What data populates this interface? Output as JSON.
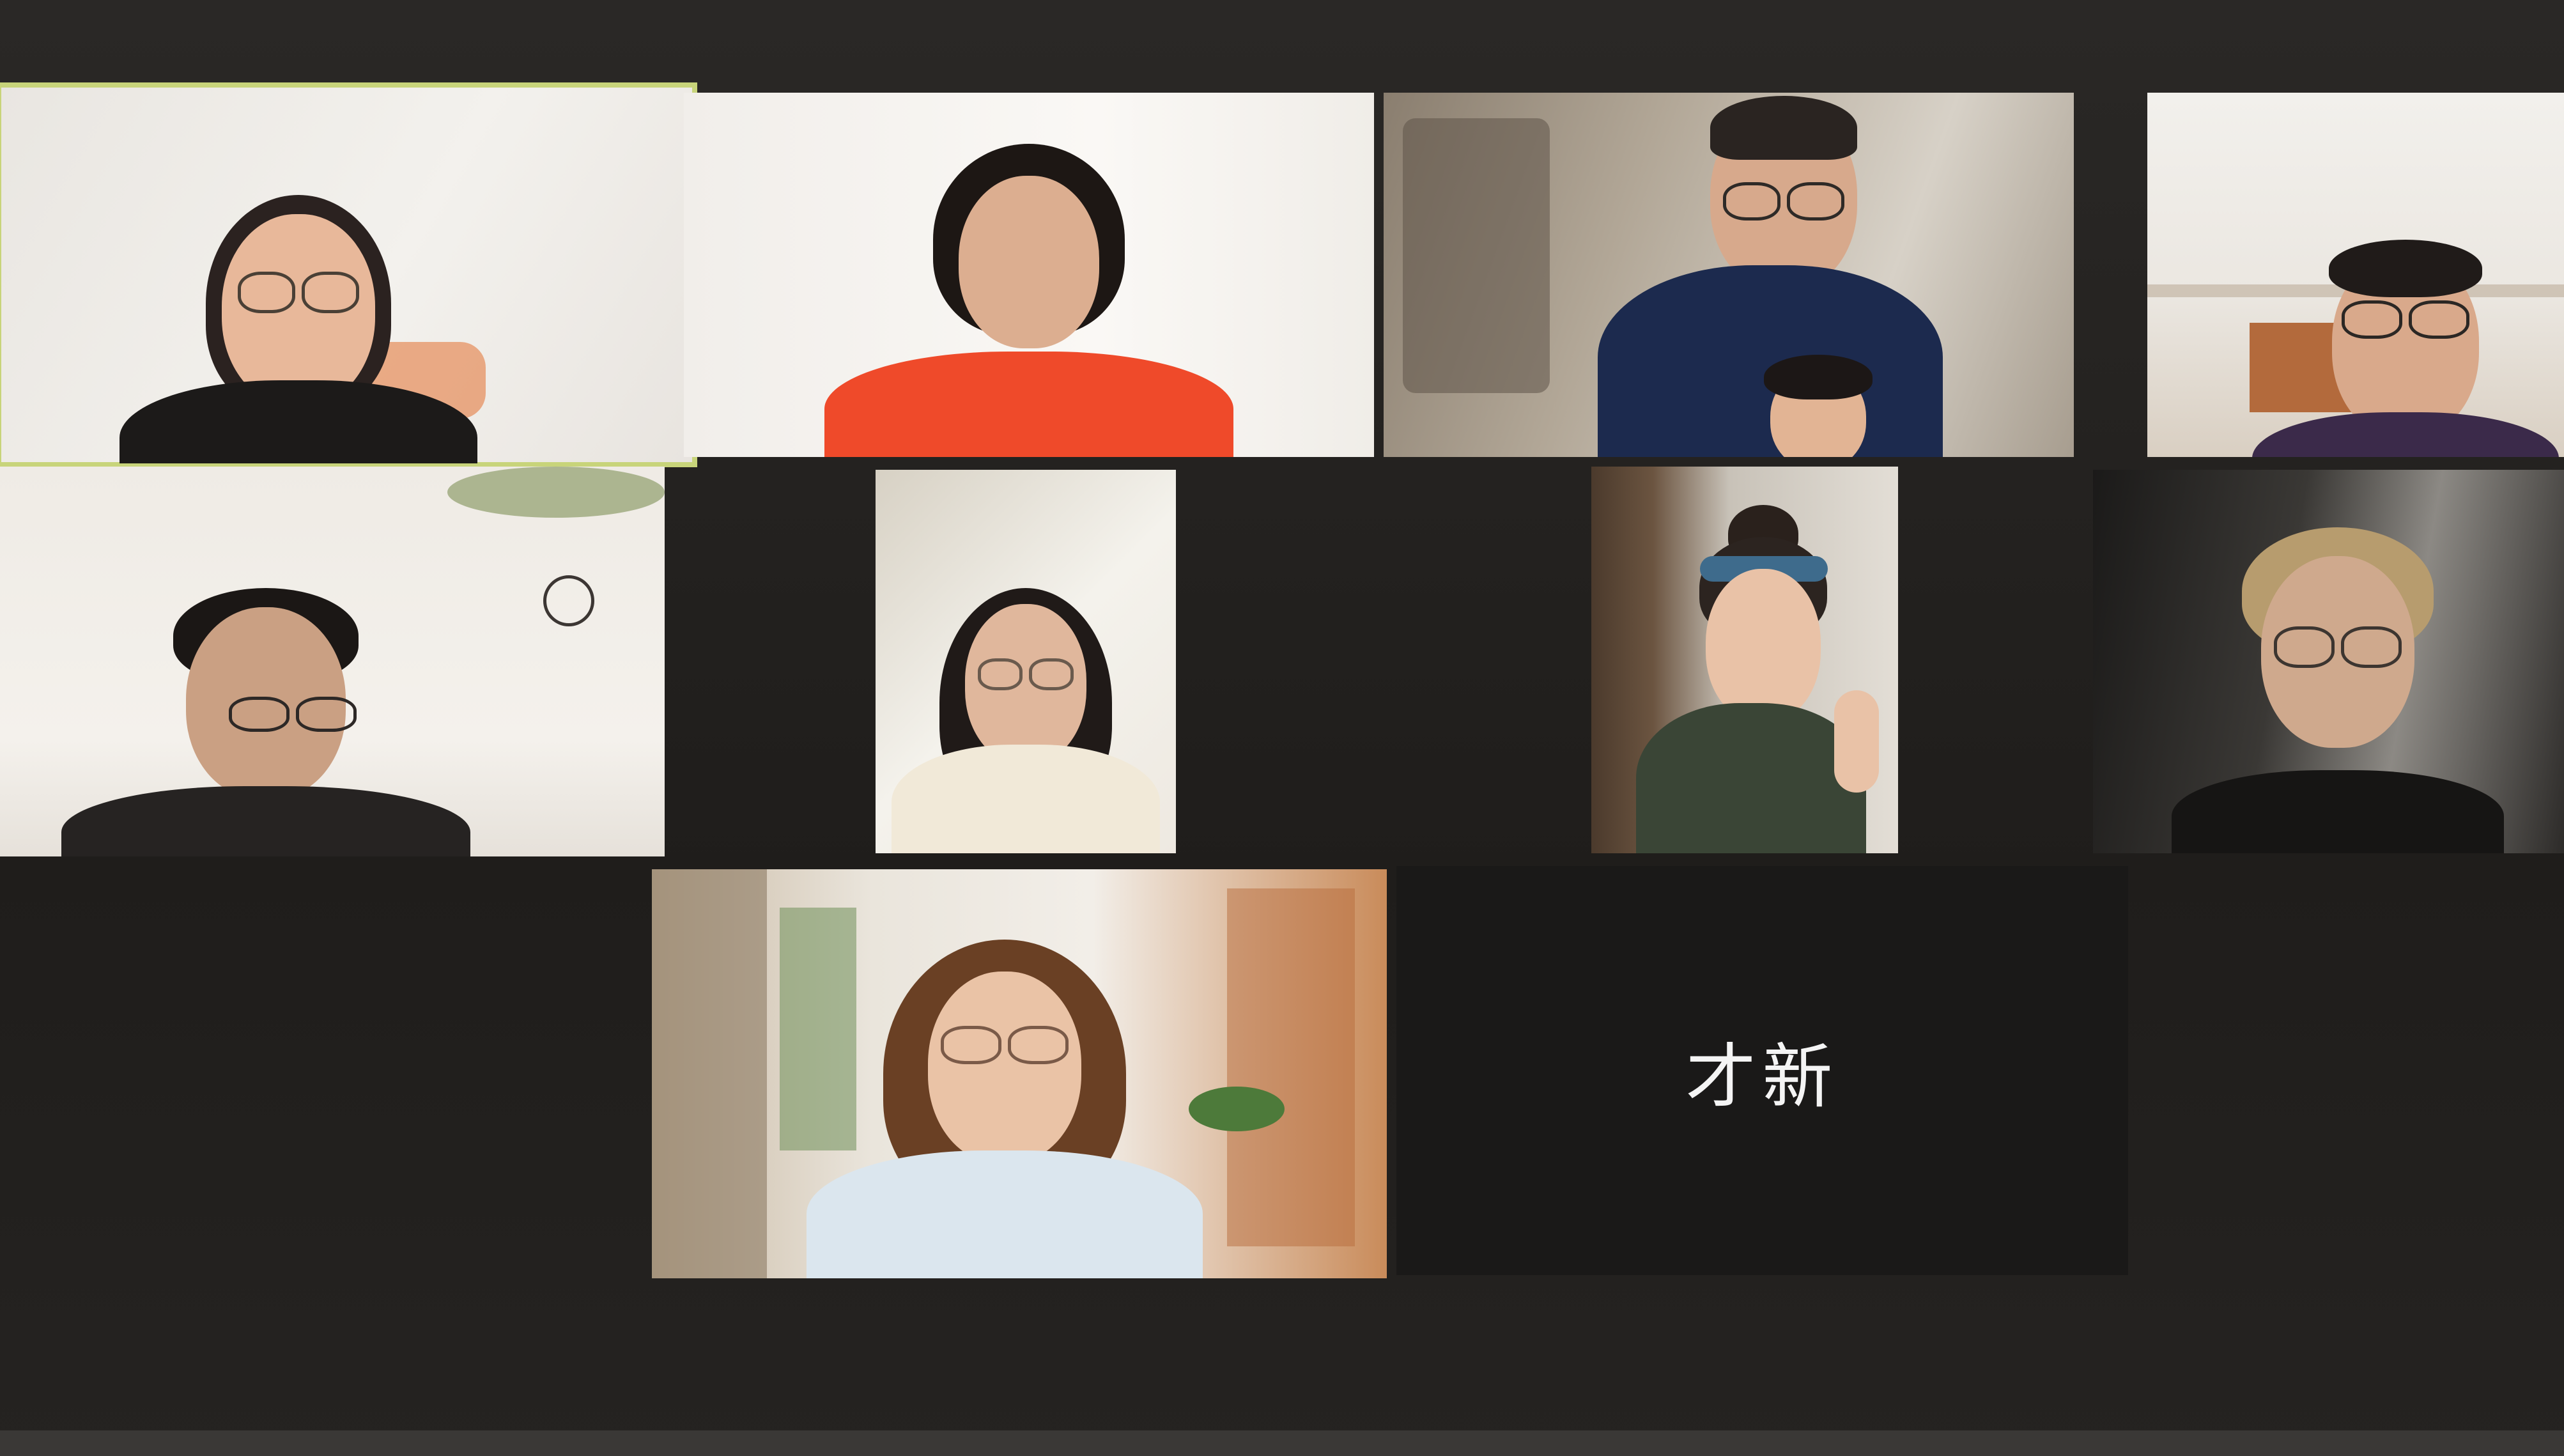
{
  "window": {
    "app": "video-conference-gallery-view"
  },
  "participants": [
    {
      "id": "p1",
      "kind": "video",
      "active_speaker": true
    },
    {
      "id": "p2",
      "kind": "video",
      "active_speaker": false
    },
    {
      "id": "p3",
      "kind": "video",
      "active_speaker": false
    },
    {
      "id": "p4",
      "kind": "video",
      "active_speaker": false
    },
    {
      "id": "p5",
      "kind": "video",
      "active_speaker": false
    },
    {
      "id": "p6",
      "kind": "video",
      "active_speaker": false
    },
    {
      "id": "p7",
      "kind": "video",
      "active_speaker": false
    },
    {
      "id": "p8",
      "kind": "video",
      "active_speaker": false
    },
    {
      "id": "p9",
      "kind": "video",
      "active_speaker": false
    },
    {
      "id": "p10",
      "kind": "name-only",
      "name": "才新",
      "active_speaker": false
    }
  ],
  "colors": {
    "active_speaker_border": "#c8d47a",
    "gallery_background": "#1f1d1b",
    "name_text": "#f4f4f4"
  }
}
